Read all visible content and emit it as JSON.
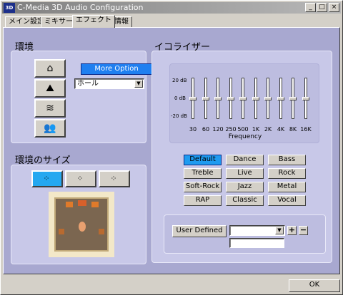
{
  "window": {
    "title": "C-Media 3D Audio Configuration",
    "icon_text": "3D"
  },
  "titlebar": {
    "minimize": "_",
    "maximize": "□",
    "close": "×"
  },
  "tabs": [
    {
      "label": "メイン設定"
    },
    {
      "label": "ミキサー"
    },
    {
      "label": "エフェクト"
    },
    {
      "label": "情報"
    }
  ],
  "environment": {
    "title": "環境",
    "icons": [
      "house-icon",
      "mountains-icon",
      "underwater-icon",
      "people-icon"
    ],
    "more_option": "More Option",
    "select_value": "ホール"
  },
  "env_size": {
    "title": "環境のサイズ",
    "buttons": [
      {
        "name": "small",
        "glyph": "⁘",
        "active": true
      },
      {
        "name": "medium",
        "glyph": "⁘",
        "active": false
      },
      {
        "name": "large",
        "glyph": "⁘",
        "active": false
      }
    ]
  },
  "equalizer": {
    "title": "イコライザー",
    "scale_top": "20 dB",
    "scale_mid": "0 dB",
    "scale_bottom": "-20 dB",
    "frequencies": [
      "30",
      "60",
      "120",
      "250",
      "500",
      "1K",
      "2K",
      "4K",
      "8K",
      "16K"
    ],
    "levels_db": [
      0,
      0,
      0,
      0,
      0,
      0,
      0,
      0,
      0,
      0
    ],
    "frequency_label": "Frequency",
    "presets": [
      "Default",
      "Dance",
      "Bass",
      "Treble",
      "Live",
      "Rock",
      "Soft-Rock",
      "Jazz",
      "Metal",
      "RAP",
      "Classic",
      "Vocal"
    ],
    "active_preset": "Default",
    "user_defined": "User  Defined",
    "user_select_value": "",
    "add": "+",
    "remove": "−",
    "name_value": ""
  },
  "footer": {
    "ok": "OK"
  },
  "colors": {
    "panel": "#a8a8d0",
    "box": "#c8c8e8",
    "accent": "#1f7ff0"
  }
}
